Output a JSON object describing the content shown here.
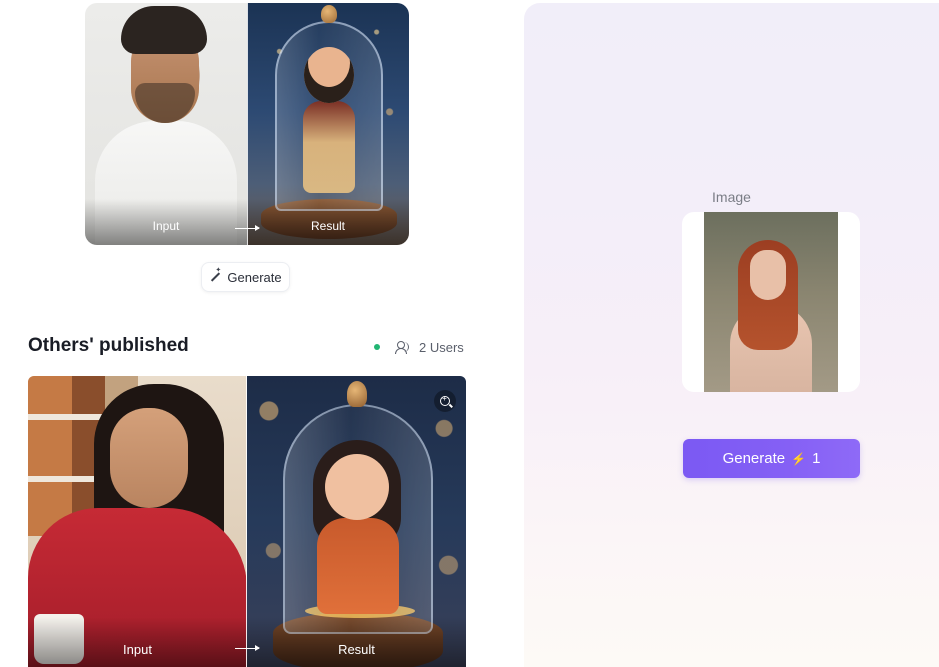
{
  "top_example": {
    "input_label": "Input",
    "result_label": "Result",
    "generate_label": "Generate"
  },
  "published": {
    "title": "Others' published",
    "users_label": "2 Users",
    "input_label": "Input",
    "result_label": "Result"
  },
  "panel": {
    "image_label": "Image",
    "generate_label": "Generate",
    "credits": "1"
  },
  "icons": {
    "generate_small": "magic-wand-icon",
    "users": "users-icon",
    "zoom": "zoom-in-icon",
    "credit": "lightning-bolt-icon",
    "arrow": "arrow-right-icon"
  },
  "colors": {
    "accent": "#7b59f3",
    "online": "#22b573"
  }
}
